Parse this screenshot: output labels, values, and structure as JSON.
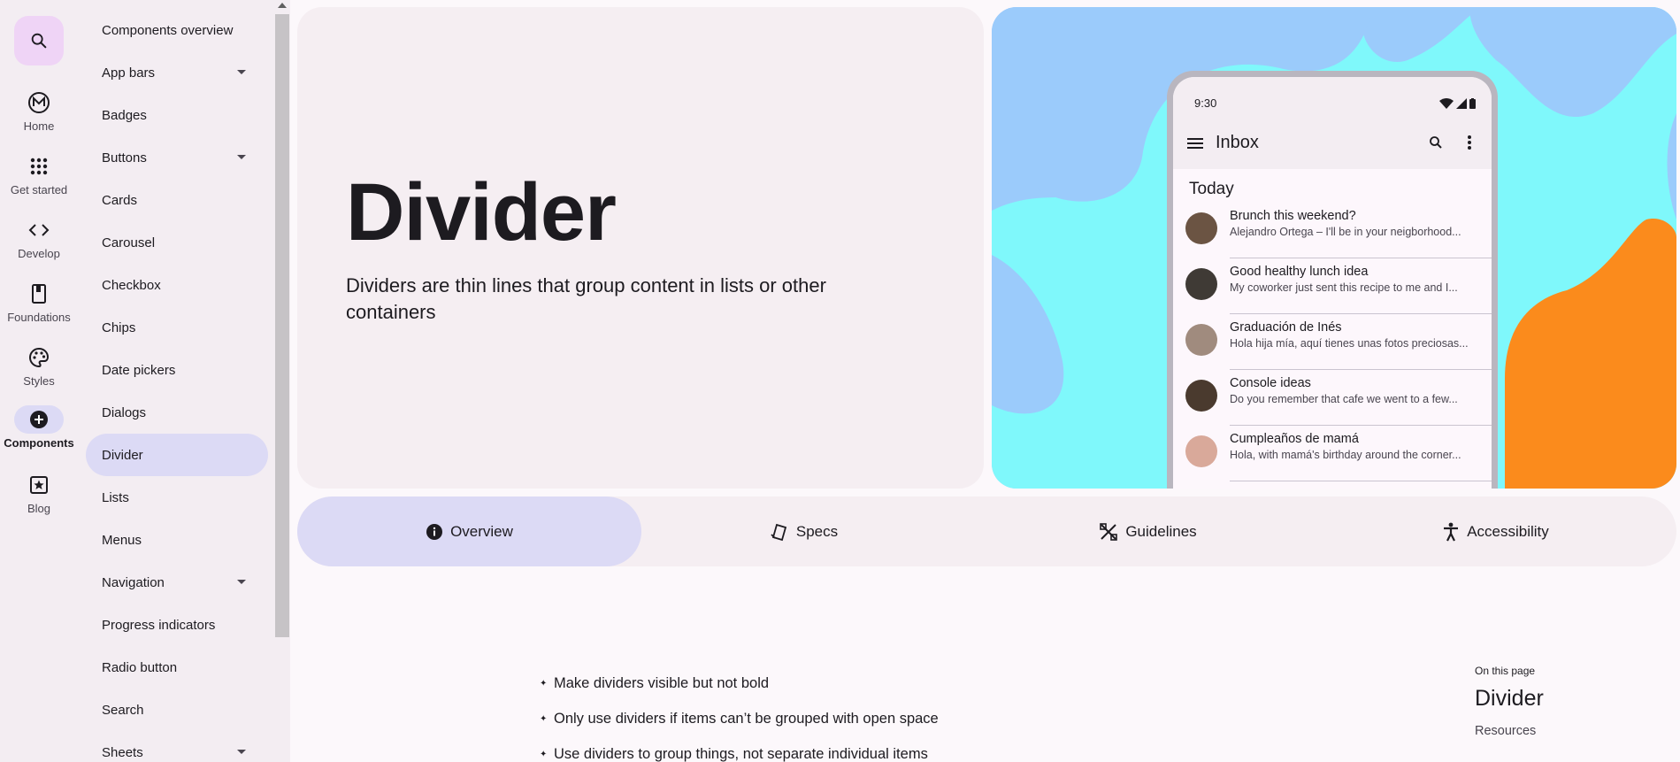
{
  "rail": {
    "items": [
      {
        "label": "Home",
        "icon": "material-logo-icon"
      },
      {
        "label": "Get started",
        "icon": "apps-grid-icon"
      },
      {
        "label": "Develop",
        "icon": "code-icon"
      },
      {
        "label": "Foundations",
        "icon": "book-icon"
      },
      {
        "label": "Styles",
        "icon": "palette-icon"
      },
      {
        "label": "Components",
        "icon": "add-circle-icon",
        "active": true
      },
      {
        "label": "Blog",
        "icon": "star-box-icon"
      }
    ]
  },
  "sidenav": {
    "items": [
      {
        "label": "Components overview"
      },
      {
        "label": "App bars",
        "expandable": true
      },
      {
        "label": "Badges"
      },
      {
        "label": "Buttons",
        "expandable": true
      },
      {
        "label": "Cards"
      },
      {
        "label": "Carousel"
      },
      {
        "label": "Checkbox"
      },
      {
        "label": "Chips"
      },
      {
        "label": "Date pickers"
      },
      {
        "label": "Dialogs"
      },
      {
        "label": "Divider",
        "active": true
      },
      {
        "label": "Lists"
      },
      {
        "label": "Menus"
      },
      {
        "label": "Navigation",
        "expandable": true
      },
      {
        "label": "Progress indicators"
      },
      {
        "label": "Radio button"
      },
      {
        "label": "Search"
      },
      {
        "label": "Sheets",
        "expandable": true
      }
    ]
  },
  "hero": {
    "title": "Divider",
    "description": "Dividers are thin lines that group content in lists or other containers"
  },
  "phone": {
    "time": "9:30",
    "app_title": "Inbox",
    "list_header": "Today",
    "mails": [
      {
        "subject": "Brunch this weekend?",
        "preview": "Alejandro Ortega – I'll be in your neigborhood...",
        "avatar_color": "#6b5443"
      },
      {
        "subject": "Good healthy lunch idea",
        "preview": "My coworker just sent this recipe to me and I...",
        "avatar_color": "#3f3a35"
      },
      {
        "subject": "Graduación de Inés",
        "preview": "Hola hija mía, aquí tienes unas fotos preciosas...",
        "avatar_color": "#a08b7e"
      },
      {
        "subject": "Console ideas",
        "preview": "Do you remember that cafe we went to a few...",
        "avatar_color": "#4a3a2e"
      },
      {
        "subject": "Cumpleaños de mamá",
        "preview": "Hola, with mamá's birthday around the corner...",
        "avatar_color": "#d9a99a"
      }
    ]
  },
  "tabs": [
    {
      "label": "Overview",
      "icon": "info-icon",
      "active": true
    },
    {
      "label": "Specs",
      "icon": "specs-icon"
    },
    {
      "label": "Guidelines",
      "icon": "guidelines-icon"
    },
    {
      "label": "Accessibility",
      "icon": "accessibility-icon"
    }
  ],
  "bullets": [
    "Make dividers visible but not bold",
    "Only use dividers if items can’t be grouped with open space",
    "Use dividers to group things, not separate individual items"
  ],
  "toc": {
    "eyebrow": "On this page",
    "title": "Divider",
    "links": [
      "Resources"
    ]
  },
  "colors": {
    "accent_container": "#dcdaf5",
    "search_container": "#efd4f6",
    "surface": "#f5eef2",
    "art_blue": "#9bcbfb",
    "art_cyan": "#7ff8fb",
    "art_orange": "#fb8b1c"
  }
}
